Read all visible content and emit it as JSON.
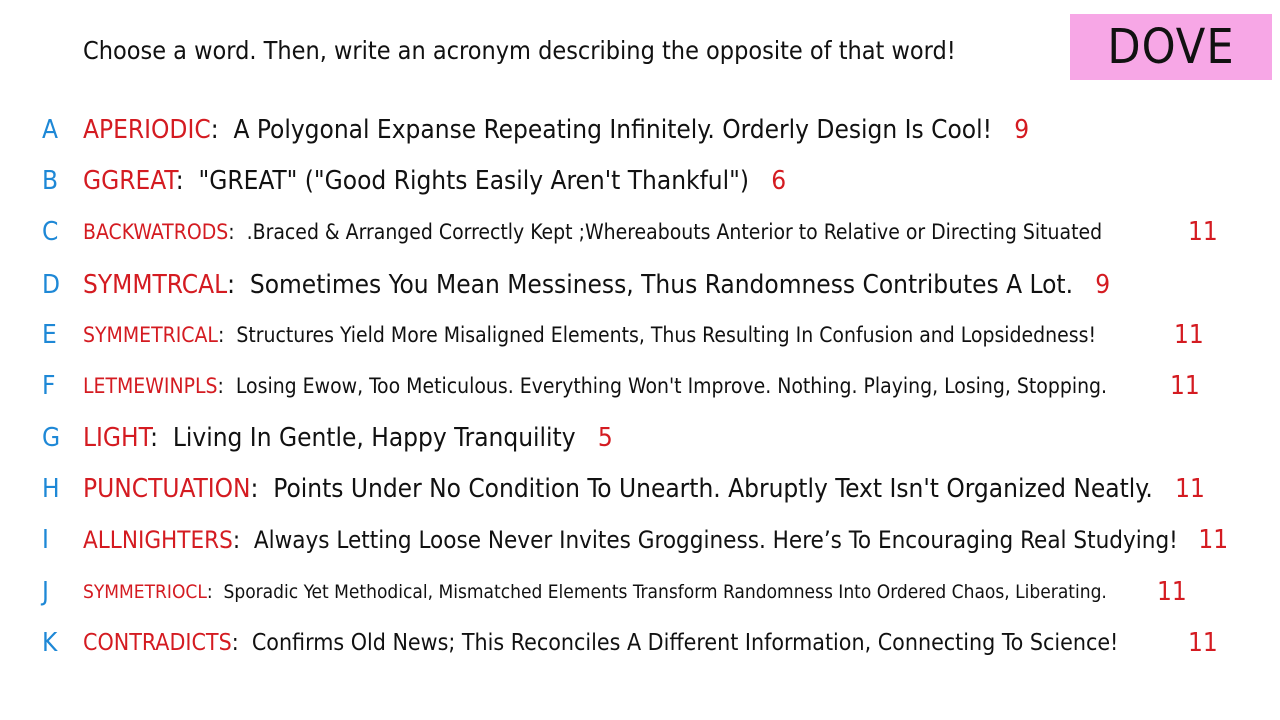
{
  "prompt": "Choose a word. Then, write an acronym describing the opposite of that word!",
  "badge": "DOVE",
  "colors": {
    "letter": "#1e88d6",
    "word": "#d41b21",
    "text": "#111111",
    "badge_bg": "#f7a7e6"
  },
  "rows": [
    {
      "letter": "A",
      "word": "APERIODIC",
      "text": "A Polygonal Expanse Repeating Infinitely. Orderly Design Is Cool!",
      "count": "9"
    },
    {
      "letter": "B",
      "word": "GGREAT",
      "text": "\"GREAT\" (\"Good Rights Easily Aren't Thankful\")",
      "count": "6"
    },
    {
      "letter": "C",
      "word": "BACKWATRODS",
      "text": ".Braced & Arranged Correctly Kept ;Whereabouts Anterior to Relative or Directing Situated",
      "count": "11"
    },
    {
      "letter": "D",
      "word": "SYMMTRCAL",
      "text": "Sometimes You Mean Messiness, Thus Randomness Contributes A Lot.",
      "count": "9"
    },
    {
      "letter": "E",
      "word": "SYMMETRICAL",
      "text": "Structures Yield More Misaligned Elements, Thus Resulting In Confusion and Lopsidedness!",
      "count": "11"
    },
    {
      "letter": "F",
      "word": "LETMEWINPLS",
      "text": "Losing Ewow, Too Meticulous. Everything Won't Improve. Nothing. Playing, Losing, Stopping.",
      "count": "11"
    },
    {
      "letter": "G",
      "word": "LIGHT",
      "text": "Living In Gentle, Happy Tranquility",
      "count": "5"
    },
    {
      "letter": "H",
      "word": "PUNCTUATION",
      "text": "Points Under No Condition To Unearth. Abruptly Text Isn't Organized Neatly.",
      "count": "11"
    },
    {
      "letter": "I",
      "word": "ALLNIGHTERS",
      "text": "Always Letting Loose Never Invites Grogginess. Here’s To Encouraging Real Studying!",
      "count": "11"
    },
    {
      "letter": "J",
      "word": "SYMMETRIOCL",
      "text": "Sporadic Yet Methodical, Mismatched Elements Transform Randomness Into Ordered Chaos, Liberating.",
      "count": "11"
    },
    {
      "letter": "K",
      "word": "CONTRADICTS",
      "text": "Confirms Old News; This Reconciles A Different Information, Connecting To Science!",
      "count": "11"
    }
  ]
}
